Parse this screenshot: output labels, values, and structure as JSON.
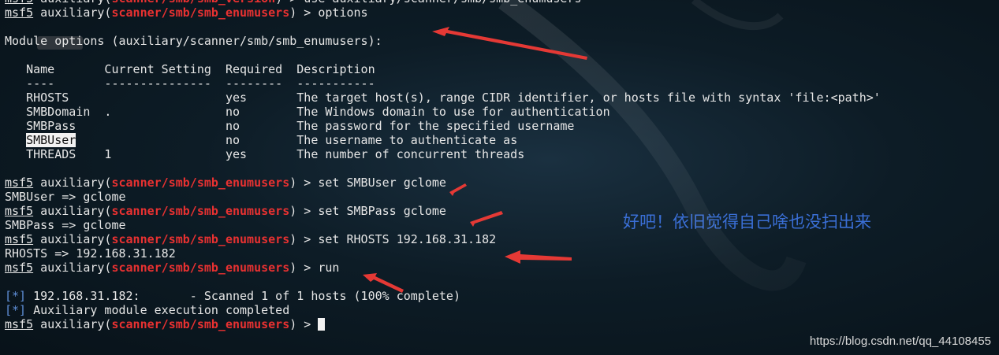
{
  "terminal": {
    "prompt_label": "msf5",
    "lines": [
      {
        "type": "prompt",
        "mod": "scanner/smb/smb_version",
        "cmd": " > use auxiliary/scanner/smb/smb_enumusers"
      },
      {
        "type": "prompt",
        "mod": "scanner/smb/smb_enumusers",
        "cmd": " > options"
      },
      {
        "type": "blank"
      },
      {
        "type": "text",
        "text": "Module options (auxiliary/scanner/smb/smb_enumusers):"
      },
      {
        "type": "blank"
      },
      {
        "type": "text",
        "text": "   Name       Current Setting  Required  Description"
      },
      {
        "type": "text",
        "text": "   ----       ---------------  --------  -----------"
      },
      {
        "type": "text",
        "text": "   RHOSTS                      yes       The target host(s), range CIDR identifier, or hosts file with syntax 'file:<path>'"
      },
      {
        "type": "text",
        "text": "   SMBDomain  .                no        The Windows domain to use for authentication"
      },
      {
        "type": "text",
        "text": "   SMBPass                     no        The password for the specified username"
      },
      {
        "type": "hl",
        "pre": "   ",
        "hl": "SMBUser",
        "post": "                     no        The username to authenticate as"
      },
      {
        "type": "text",
        "text": "   THREADS    1                yes       The number of concurrent threads"
      },
      {
        "type": "blank"
      },
      {
        "type": "prompt",
        "mod": "scanner/smb/smb_enumusers",
        "cmd": " > set SMBUser gclome"
      },
      {
        "type": "text",
        "text": "SMBUser => gclome"
      },
      {
        "type": "prompt",
        "mod": "scanner/smb/smb_enumusers",
        "cmd": " > set SMBPass gclome"
      },
      {
        "type": "text",
        "text": "SMBPass => gclome"
      },
      {
        "type": "prompt",
        "mod": "scanner/smb/smb_enumusers",
        "cmd": " > set RHOSTS 192.168.31.182"
      },
      {
        "type": "text",
        "text": "RHOSTS => 192.168.31.182"
      },
      {
        "type": "prompt",
        "mod": "scanner/smb/smb_enumusers",
        "cmd": " > run"
      },
      {
        "type": "blank"
      },
      {
        "type": "info",
        "tag": "[*]",
        "text": " 192.168.31.182:       - Scanned 1 of 1 hosts (100% complete)"
      },
      {
        "type": "info",
        "tag": "[*]",
        "text": " Auxiliary module execution completed"
      },
      {
        "type": "cursor",
        "mod": "scanner/smb/smb_enumusers",
        "cmd": " > "
      }
    ]
  },
  "annotation": {
    "note": "好吧！依旧觉得自己啥也没扫出来"
  },
  "watermark": "https://blog.csdn.net/qq_44108455",
  "colors": {
    "module": "#e83131",
    "info": "#5f8fd8",
    "arrow": "#e53935",
    "note": "#3a6fd6"
  }
}
